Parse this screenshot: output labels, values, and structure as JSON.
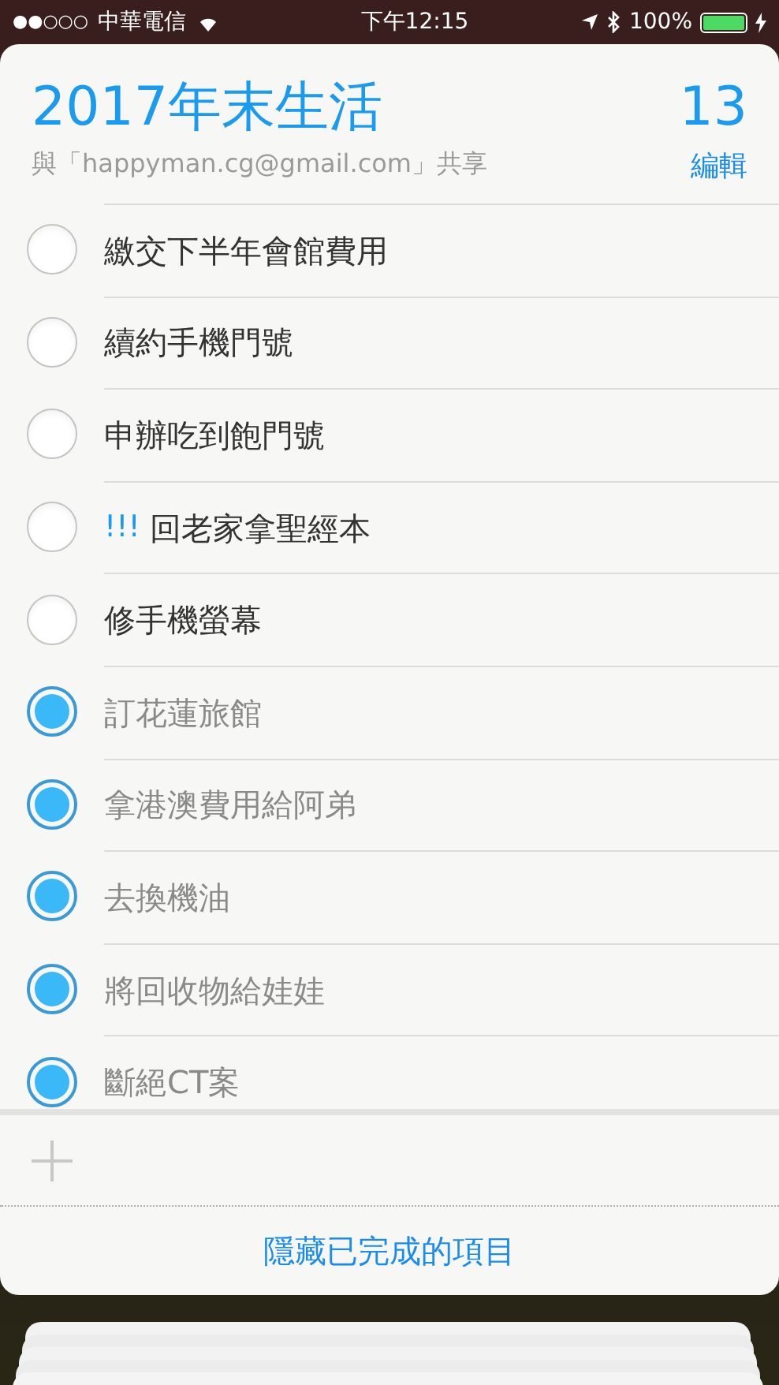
{
  "status_bar": {
    "signal": "●●○○○",
    "carrier": "中華電信",
    "time": "下午12:15",
    "battery": "100%"
  },
  "list": {
    "title": "2017年末生活",
    "count": "13",
    "shared": "與「happyman.cg@gmail.com」共享",
    "edit": "編輯"
  },
  "items": [
    {
      "text": "繳交下半年會館費用",
      "checked": false
    },
    {
      "text": "續約手機門號",
      "checked": false
    },
    {
      "text": "申辦吃到飽門號",
      "checked": false
    },
    {
      "priority": "!!!",
      "text": "回老家拿聖經本",
      "checked": false
    },
    {
      "text": "修手機螢幕",
      "checked": false
    },
    {
      "text": "訂花蓮旅館",
      "checked": true
    },
    {
      "text": "拿港澳費用給阿弟",
      "checked": true
    },
    {
      "text": "去換機油",
      "checked": true
    },
    {
      "text": "將回收物給娃娃",
      "checked": true
    },
    {
      "text": "斷絕CT案",
      "checked": true
    }
  ],
  "footer": {
    "hide_completed": "隱藏已完成的項目"
  }
}
